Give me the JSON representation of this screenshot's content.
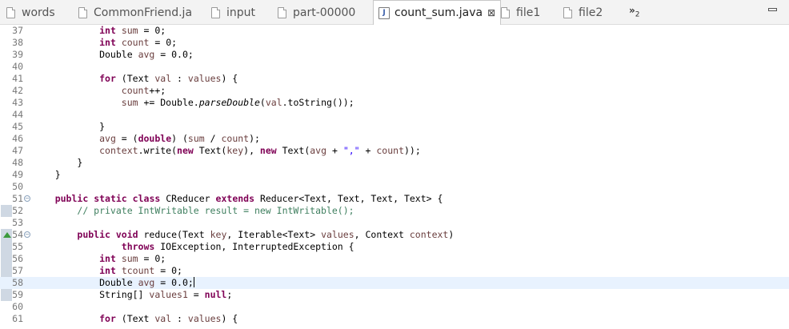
{
  "tabs": [
    {
      "label": "words",
      "icon": "file-icon"
    },
    {
      "label": "CommonFriend.ja",
      "icon": "file-icon"
    },
    {
      "label": "input",
      "icon": "file-icon"
    },
    {
      "label": "part-00000",
      "icon": "file-icon"
    },
    {
      "label": "count_sum.java",
      "icon": "java-file-icon",
      "active": true,
      "close": "⊠"
    },
    {
      "label": "file1",
      "icon": "file-icon"
    },
    {
      "label": "file2",
      "icon": "file-icon"
    }
  ],
  "overflow": {
    "symbol": "»",
    "count": "2"
  },
  "editor": {
    "lines": [
      {
        "n": "37",
        "tokens": [
          [
            "",
            "            "
          ],
          [
            "kw",
            "int"
          ],
          [
            "",
            " "
          ],
          [
            "var",
            "sum"
          ],
          [
            "",
            " = 0;"
          ]
        ]
      },
      {
        "n": "38",
        "tokens": [
          [
            "",
            "            "
          ],
          [
            "kw",
            "int"
          ],
          [
            "",
            " "
          ],
          [
            "var",
            "count"
          ],
          [
            "",
            " = 0;"
          ]
        ]
      },
      {
        "n": "39",
        "tokens": [
          [
            "",
            "            Double "
          ],
          [
            "var",
            "avg"
          ],
          [
            "",
            " = 0.0;"
          ]
        ]
      },
      {
        "n": "40",
        "tokens": []
      },
      {
        "n": "41",
        "tokens": [
          [
            "",
            "            "
          ],
          [
            "kw",
            "for"
          ],
          [
            "",
            " (Text "
          ],
          [
            "var",
            "val"
          ],
          [
            "",
            " : "
          ],
          [
            "var",
            "values"
          ],
          [
            "",
            ") {"
          ]
        ]
      },
      {
        "n": "42",
        "tokens": [
          [
            "",
            "                "
          ],
          [
            "var",
            "count"
          ],
          [
            "",
            "++;"
          ]
        ]
      },
      {
        "n": "43",
        "tokens": [
          [
            "",
            "                "
          ],
          [
            "var",
            "sum"
          ],
          [
            "",
            " += Double."
          ],
          [
            "it",
            "parseDouble"
          ],
          [
            "",
            "("
          ],
          [
            "var",
            "val"
          ],
          [
            "",
            ".toString());"
          ]
        ]
      },
      {
        "n": "44",
        "tokens": []
      },
      {
        "n": "45",
        "tokens": [
          [
            "",
            "            }"
          ]
        ]
      },
      {
        "n": "46",
        "tokens": [
          [
            "",
            "            "
          ],
          [
            "var",
            "avg"
          ],
          [
            "",
            " = ("
          ],
          [
            "kw",
            "double"
          ],
          [
            "",
            ") ("
          ],
          [
            "var",
            "sum"
          ],
          [
            "",
            " / "
          ],
          [
            "var",
            "count"
          ],
          [
            "",
            ");"
          ]
        ]
      },
      {
        "n": "47",
        "tokens": [
          [
            "",
            "            "
          ],
          [
            "var",
            "context"
          ],
          [
            "",
            ".write("
          ],
          [
            "kw",
            "new"
          ],
          [
            "",
            " Text("
          ],
          [
            "var",
            "key"
          ],
          [
            "",
            "), "
          ],
          [
            "kw",
            "new"
          ],
          [
            "",
            " Text("
          ],
          [
            "var",
            "avg"
          ],
          [
            "",
            " + "
          ],
          [
            "str",
            "\",\""
          ],
          [
            "",
            " + "
          ],
          [
            "var",
            "count"
          ],
          [
            "",
            "));"
          ]
        ]
      },
      {
        "n": "48",
        "tokens": [
          [
            "",
            "        }"
          ]
        ]
      },
      {
        "n": "49",
        "tokens": [
          [
            "",
            "    }"
          ]
        ]
      },
      {
        "n": "50",
        "tokens": []
      },
      {
        "n": "51",
        "fold": true,
        "tokens": [
          [
            "",
            "    "
          ],
          [
            "kw",
            "public"
          ],
          [
            "",
            " "
          ],
          [
            "kw",
            "static"
          ],
          [
            "",
            " "
          ],
          [
            "kw",
            "class"
          ],
          [
            "",
            " CReducer "
          ],
          [
            "kw",
            "extends"
          ],
          [
            "",
            " Reducer<Text, Text, Text, Text> {"
          ]
        ]
      },
      {
        "n": "52",
        "tokens": [
          [
            "",
            "        "
          ],
          [
            "cmt",
            "// private IntWritable result = new IntWritable();"
          ]
        ]
      },
      {
        "n": "53",
        "tokens": []
      },
      {
        "n": "54",
        "fold": true,
        "override": true,
        "tokens": [
          [
            "",
            "        "
          ],
          [
            "kw",
            "public"
          ],
          [
            "",
            " "
          ],
          [
            "kw",
            "void"
          ],
          [
            "",
            " reduce(Text "
          ],
          [
            "var",
            "key"
          ],
          [
            "",
            ", Iterable<Text> "
          ],
          [
            "var",
            "values"
          ],
          [
            "",
            ", Context "
          ],
          [
            "var",
            "context"
          ],
          [
            "",
            ")"
          ]
        ]
      },
      {
        "n": "55",
        "tokens": [
          [
            "",
            "                "
          ],
          [
            "kw",
            "throws"
          ],
          [
            "",
            " IOException, InterruptedException {"
          ]
        ]
      },
      {
        "n": "56",
        "tokens": [
          [
            "",
            "            "
          ],
          [
            "kw",
            "int"
          ],
          [
            "",
            " "
          ],
          [
            "var",
            "sum"
          ],
          [
            "",
            " = 0;"
          ]
        ]
      },
      {
        "n": "57",
        "tokens": [
          [
            "",
            "            "
          ],
          [
            "kw",
            "int"
          ],
          [
            "",
            " "
          ],
          [
            "var",
            "tcount"
          ],
          [
            "",
            " = 0;"
          ]
        ]
      },
      {
        "n": "58",
        "current": true,
        "tokens": [
          [
            "",
            "            Double "
          ],
          [
            "var",
            "avg"
          ],
          [
            "",
            " = 0.0;"
          ]
        ]
      },
      {
        "n": "59",
        "tokens": [
          [
            "",
            "            String[] "
          ],
          [
            "var",
            "values1"
          ],
          [
            "",
            " = "
          ],
          [
            "kw",
            "null"
          ],
          [
            "",
            ";"
          ]
        ]
      },
      {
        "n": "60",
        "tokens": []
      },
      {
        "n": "61",
        "tokens": [
          [
            "",
            "            "
          ],
          [
            "kw",
            "for"
          ],
          [
            "",
            " (Text "
          ],
          [
            "var",
            "val"
          ],
          [
            "",
            " : "
          ],
          [
            "var",
            "values"
          ],
          [
            "",
            ") {"
          ]
        ]
      }
    ]
  }
}
